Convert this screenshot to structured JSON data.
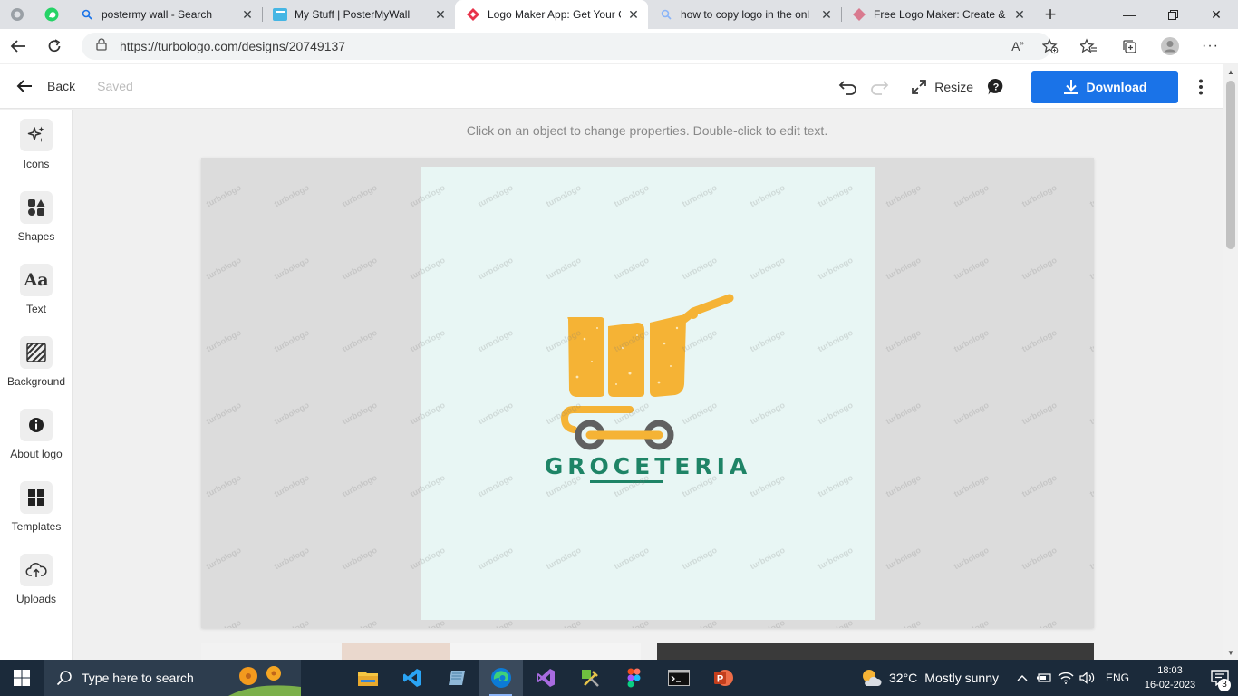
{
  "browser": {
    "tabs": [
      {
        "title": "postermy wall - Search",
        "icon": "search-icon",
        "active": false
      },
      {
        "title": "My Stuff | PosterMyWall",
        "icon": "postermywall-icon",
        "active": false
      },
      {
        "title": "Logo Maker App: Get Your C",
        "icon": "turbologo-icon",
        "active": true
      },
      {
        "title": "how to copy logo in the onl",
        "icon": "search-icon",
        "active": false
      },
      {
        "title": "Free Logo Maker: Create & ",
        "icon": "logo-maker-icon",
        "active": false
      }
    ],
    "url": "https://turbologo.com/designs/20749137"
  },
  "app": {
    "back_label": "Back",
    "saved_label": "Saved",
    "resize_label": "Resize",
    "download_label": "Download",
    "accent": "#1a73e8"
  },
  "sidebar": {
    "items": [
      {
        "label": "Icons",
        "icon": "sparkle-icon"
      },
      {
        "label": "Shapes",
        "icon": "shapes-icon"
      },
      {
        "label": "Text",
        "icon": "text-icon"
      },
      {
        "label": "Background",
        "icon": "background-pattern-icon"
      },
      {
        "label": "About logo",
        "icon": "info-icon"
      },
      {
        "label": "Templates",
        "icon": "templates-icon"
      },
      {
        "label": "Uploads",
        "icon": "upload-cloud-icon"
      }
    ]
  },
  "canvas": {
    "hint": "Click on an object to change properties. Double-click to edit text.",
    "watermark": "turbologo",
    "logo_text": "GROCETERIA",
    "logo_text_color": "#1e8466",
    "logo_icon_color": "#f5b335",
    "background_color": "#e8f6f4"
  },
  "taskbar": {
    "search_placeholder": "Type here to search",
    "temperature": "32°C",
    "weather": "Mostly sunny",
    "language": "ENG",
    "time": "18:03",
    "date": "16-02-2023",
    "notification_count": "3"
  }
}
